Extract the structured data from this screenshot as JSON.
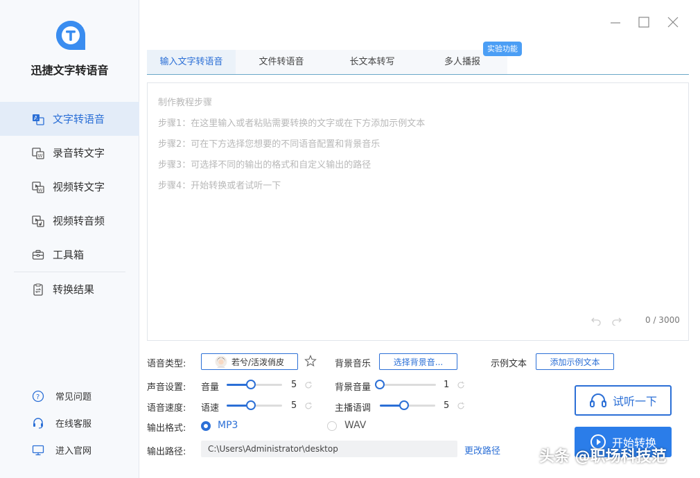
{
  "app": {
    "name": "迅捷文字转语音"
  },
  "sidebar": {
    "items": [
      {
        "label": "文字转语音",
        "icon": "text-to-speech-icon",
        "active": true
      },
      {
        "label": "录音转文字",
        "icon": "recording-to-text-icon"
      },
      {
        "label": "视频转文字",
        "icon": "video-to-text-icon"
      },
      {
        "label": "视频转音频",
        "icon": "video-to-audio-icon"
      },
      {
        "label": "工具箱",
        "icon": "toolbox-icon"
      },
      {
        "label": "转换结果",
        "icon": "results-icon"
      }
    ],
    "bottom": [
      {
        "label": "常见问题",
        "icon": "question-icon"
      },
      {
        "label": "在线客服",
        "icon": "headset-icon"
      },
      {
        "label": "进入官网",
        "icon": "monitor-icon"
      }
    ]
  },
  "tabs": [
    {
      "label": "输入文字转语音",
      "active": true
    },
    {
      "label": "文件转语音"
    },
    {
      "label": "长文本转写"
    },
    {
      "label": "多人播报"
    }
  ],
  "badge": "实验功能",
  "editor": {
    "placeholder_lines": [
      "制作教程步骤",
      "步骤1：在这里输入或者粘贴需要转换的文字或在下方添加示例文本",
      "步骤2：可在下方选择您想要的不同语音配置和背景音乐",
      "步骤3：可选择不同的输出的格式和自定义输出的路径",
      "步骤4：开始转换或者试听一下"
    ],
    "counter": "0 / 3000"
  },
  "settings": {
    "voice_type_label": "语音类型:",
    "voice_name": "若兮/活泼俏皮",
    "bgm_label": "背景音乐",
    "bgm_button": "选择背景音...",
    "sample_label": "示例文本",
    "sample_button": "添加示例文本",
    "sound_label": "声音设置:",
    "volume_label": "音量",
    "volume_value": "5",
    "bgm_volume_label": "背景音量",
    "bgm_volume_value": "1",
    "speed_label": "语音速度:",
    "speed_sub_label": "语速",
    "speed_value": "5",
    "pitch_label": "主播语调",
    "pitch_value": "5",
    "format_label": "输出格式:",
    "format_mp3": "MP3",
    "format_wav": "WAV",
    "path_label": "输出路径:",
    "path_value": "C:\\Users\\Administrator\\desktop",
    "change_path": "更改路径"
  },
  "actions": {
    "listen": "试听一下",
    "start": "开始转换"
  },
  "watermark": "头条 @职场科技范",
  "colors": {
    "accent": "#2b6fd6"
  }
}
